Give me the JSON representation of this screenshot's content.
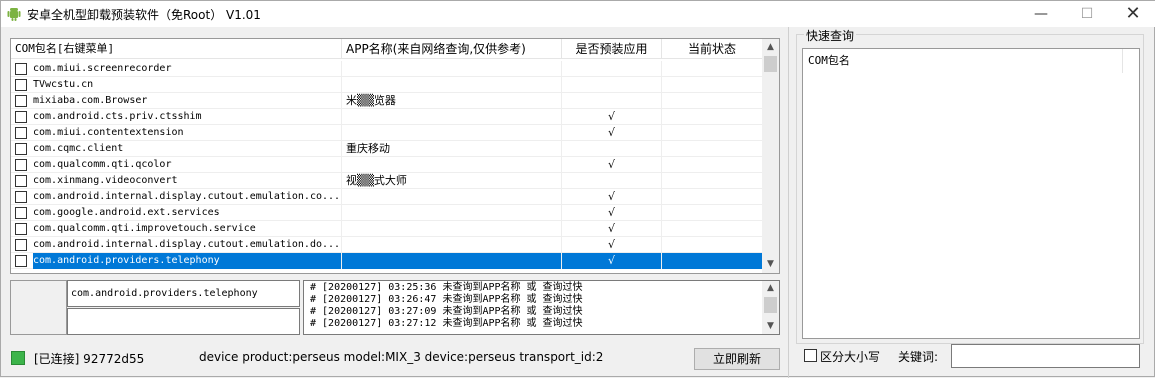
{
  "window": {
    "title": "安卓全机型卸载预装软件（免Root） V1.01",
    "min_glyph": "—",
    "max_glyph": "☐",
    "close_glyph": "✕"
  },
  "table": {
    "headers": [
      "COM包名[右键菜单]",
      "APP名称(来自网络查询,仅供参考)",
      "是否预装应用",
      "当前状态"
    ],
    "rows": [
      {
        "pkg": "com.miui.screenrecorder",
        "app": "",
        "pre": "",
        "status": ""
      },
      {
        "pkg": "TVwcstu.cn",
        "app": "",
        "pre": "",
        "status": ""
      },
      {
        "pkg": "mixiaba.com.Browser",
        "app": "米▒▒览器",
        "pre": "",
        "status": ""
      },
      {
        "pkg": "com.android.cts.priv.ctsshim",
        "app": "",
        "pre": "√",
        "status": ""
      },
      {
        "pkg": "com.miui.contentextension",
        "app": "",
        "pre": "√",
        "status": ""
      },
      {
        "pkg": "com.cqmc.client",
        "app": "重庆移动",
        "pre": "",
        "status": ""
      },
      {
        "pkg": "com.qualcomm.qti.qcolor",
        "app": "",
        "pre": "√",
        "status": ""
      },
      {
        "pkg": "com.xinmang.videoconvert",
        "app": "视▒▒式大师",
        "pre": "",
        "status": ""
      },
      {
        "pkg": "com.android.internal.display.cutout.emulation.co...",
        "app": "",
        "pre": "√",
        "status": ""
      },
      {
        "pkg": "com.google.android.ext.services",
        "app": "",
        "pre": "√",
        "status": ""
      },
      {
        "pkg": "com.qualcomm.qti.improvetouch.service",
        "app": "",
        "pre": "√",
        "status": ""
      },
      {
        "pkg": "com.android.internal.display.cutout.emulation.do...",
        "app": "",
        "pre": "√",
        "status": ""
      },
      {
        "pkg": "com.android.providers.telephony",
        "app": "",
        "pre": "√",
        "status": "",
        "selected": true
      }
    ],
    "scroll_up": "▲",
    "scroll_down": "▼"
  },
  "detail": {
    "package_value": "com.android.providers.telephony",
    "second_value": ""
  },
  "log": {
    "lines": [
      "# [20200127] 03:25:36 未查询到APP名称 或 查询过快",
      "# [20200127] 03:26:47 未查询到APP名称 或 查询过快",
      "# [20200127] 03:27:09 未查询到APP名称 或 查询过快",
      "# [20200127] 03:27:12 未查询到APP名称 或 查询过快"
    ],
    "scroll_up": "▲",
    "scroll_down": "▼"
  },
  "status": {
    "connection": "[已连接] 92772d55",
    "device": "device product:perseus model:MIX_3 device:perseus transport_id:2",
    "refresh_label": "立即刷新",
    "led_color": "#3cb44a"
  },
  "quick": {
    "group_label": "快速查询",
    "list_header": "COM包名",
    "case_label": "区分大小写",
    "keyword_label": "关键词:",
    "keyword_value": ""
  }
}
